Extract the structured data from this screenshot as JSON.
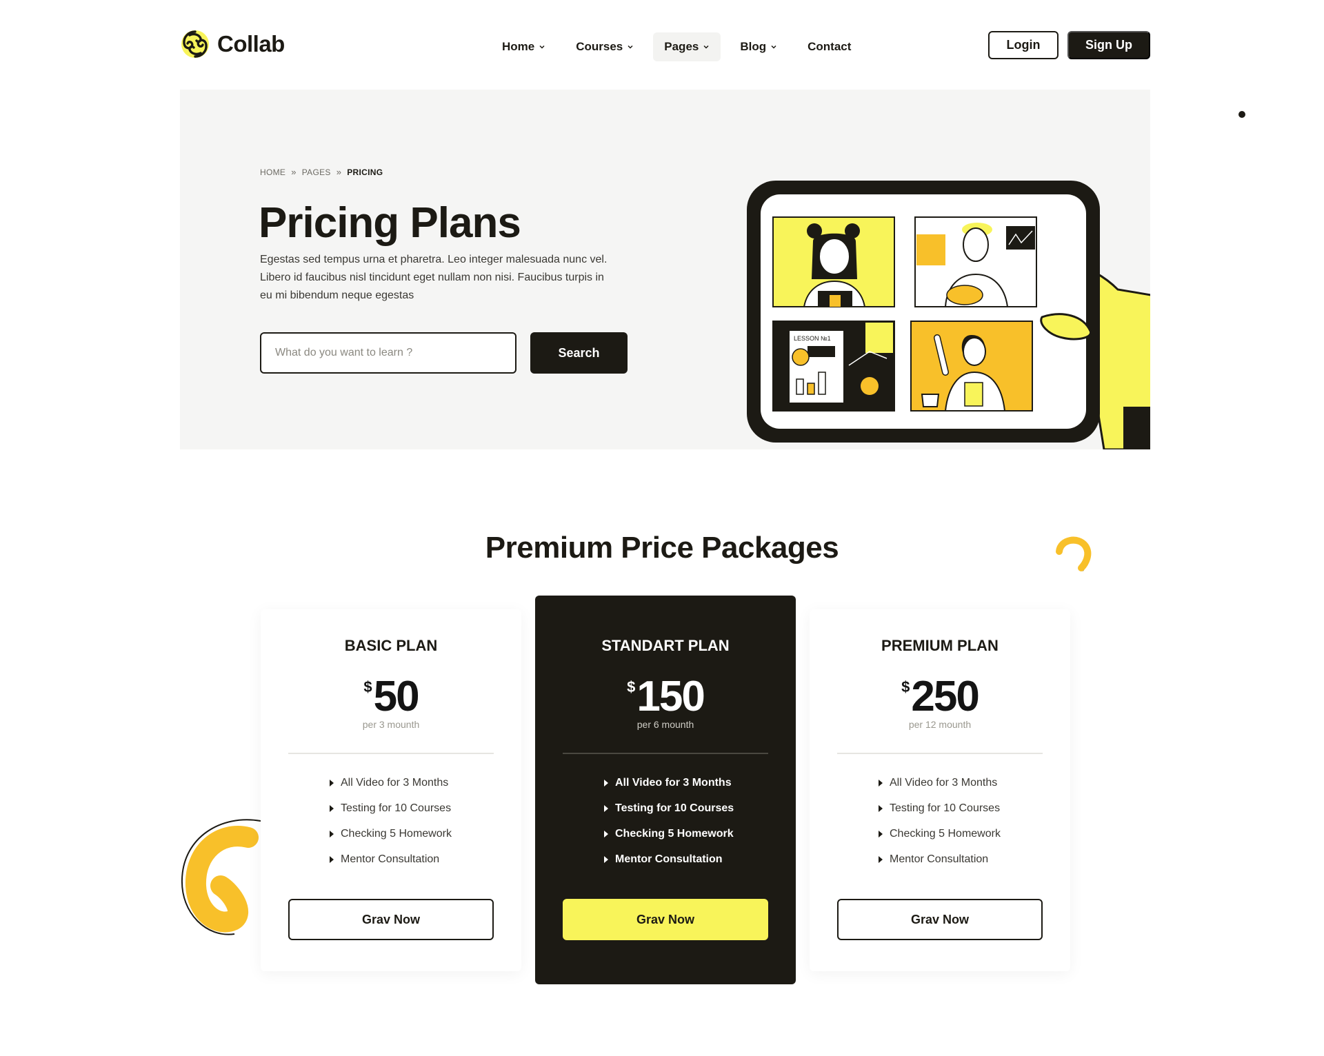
{
  "brand": {
    "name": "Collab",
    "logo_icon": "collab-logo-icon",
    "accent": "#f8f45a",
    "dark": "#1c1a14"
  },
  "nav": {
    "items": [
      {
        "label": "Home",
        "has_dropdown": true
      },
      {
        "label": "Courses",
        "has_dropdown": true
      },
      {
        "label": "Pages",
        "has_dropdown": true,
        "active": true
      },
      {
        "label": "Blog",
        "has_dropdown": true
      },
      {
        "label": "Contact",
        "has_dropdown": false
      }
    ],
    "login_label": "Login",
    "signup_label": "Sign Up"
  },
  "hero": {
    "breadcrumb": [
      "HOME",
      "PAGES",
      "PRICING"
    ],
    "title": "Pricing Plans",
    "description": "Egestas sed tempus urna et pharetra. Leo integer malesuada nunc vel. Libero id faucibus nisl tincidunt eget nullam non nisi. Faucibus turpis in eu mi bibendum neque egestas",
    "search_placeholder": "What do you want to learn ?",
    "search_button": "Search",
    "illustration_lesson_label": "LESSON №1"
  },
  "pricing": {
    "title": "Premium Price Packages",
    "plans": [
      {
        "name": "BASIC PLAN",
        "currency": "$",
        "price": "50",
        "period": "per 3 mounth",
        "features": [
          "All Video for 3 Months",
          "Testing for 10 Courses",
          "Checking 5 Homework",
          "Mentor Consultation"
        ],
        "button": "Grav Now",
        "highlighted": false
      },
      {
        "name": "STANDART PLAN",
        "currency": "$",
        "price": "150",
        "period": "per 6 mounth",
        "features": [
          "All Video for 3 Months",
          "Testing for 10 Courses",
          "Checking 5 Homework",
          "Mentor Consultation"
        ],
        "button": "Grav Now",
        "highlighted": true
      },
      {
        "name": "PREMIUM PLAN",
        "currency": "$",
        "price": "250",
        "period": "per 12 mounth",
        "features": [
          "All Video for 3 Months",
          "Testing for 10 Courses",
          "Checking 5 Homework",
          "Mentor Consultation"
        ],
        "button": "Grav Now",
        "highlighted": false
      }
    ]
  }
}
